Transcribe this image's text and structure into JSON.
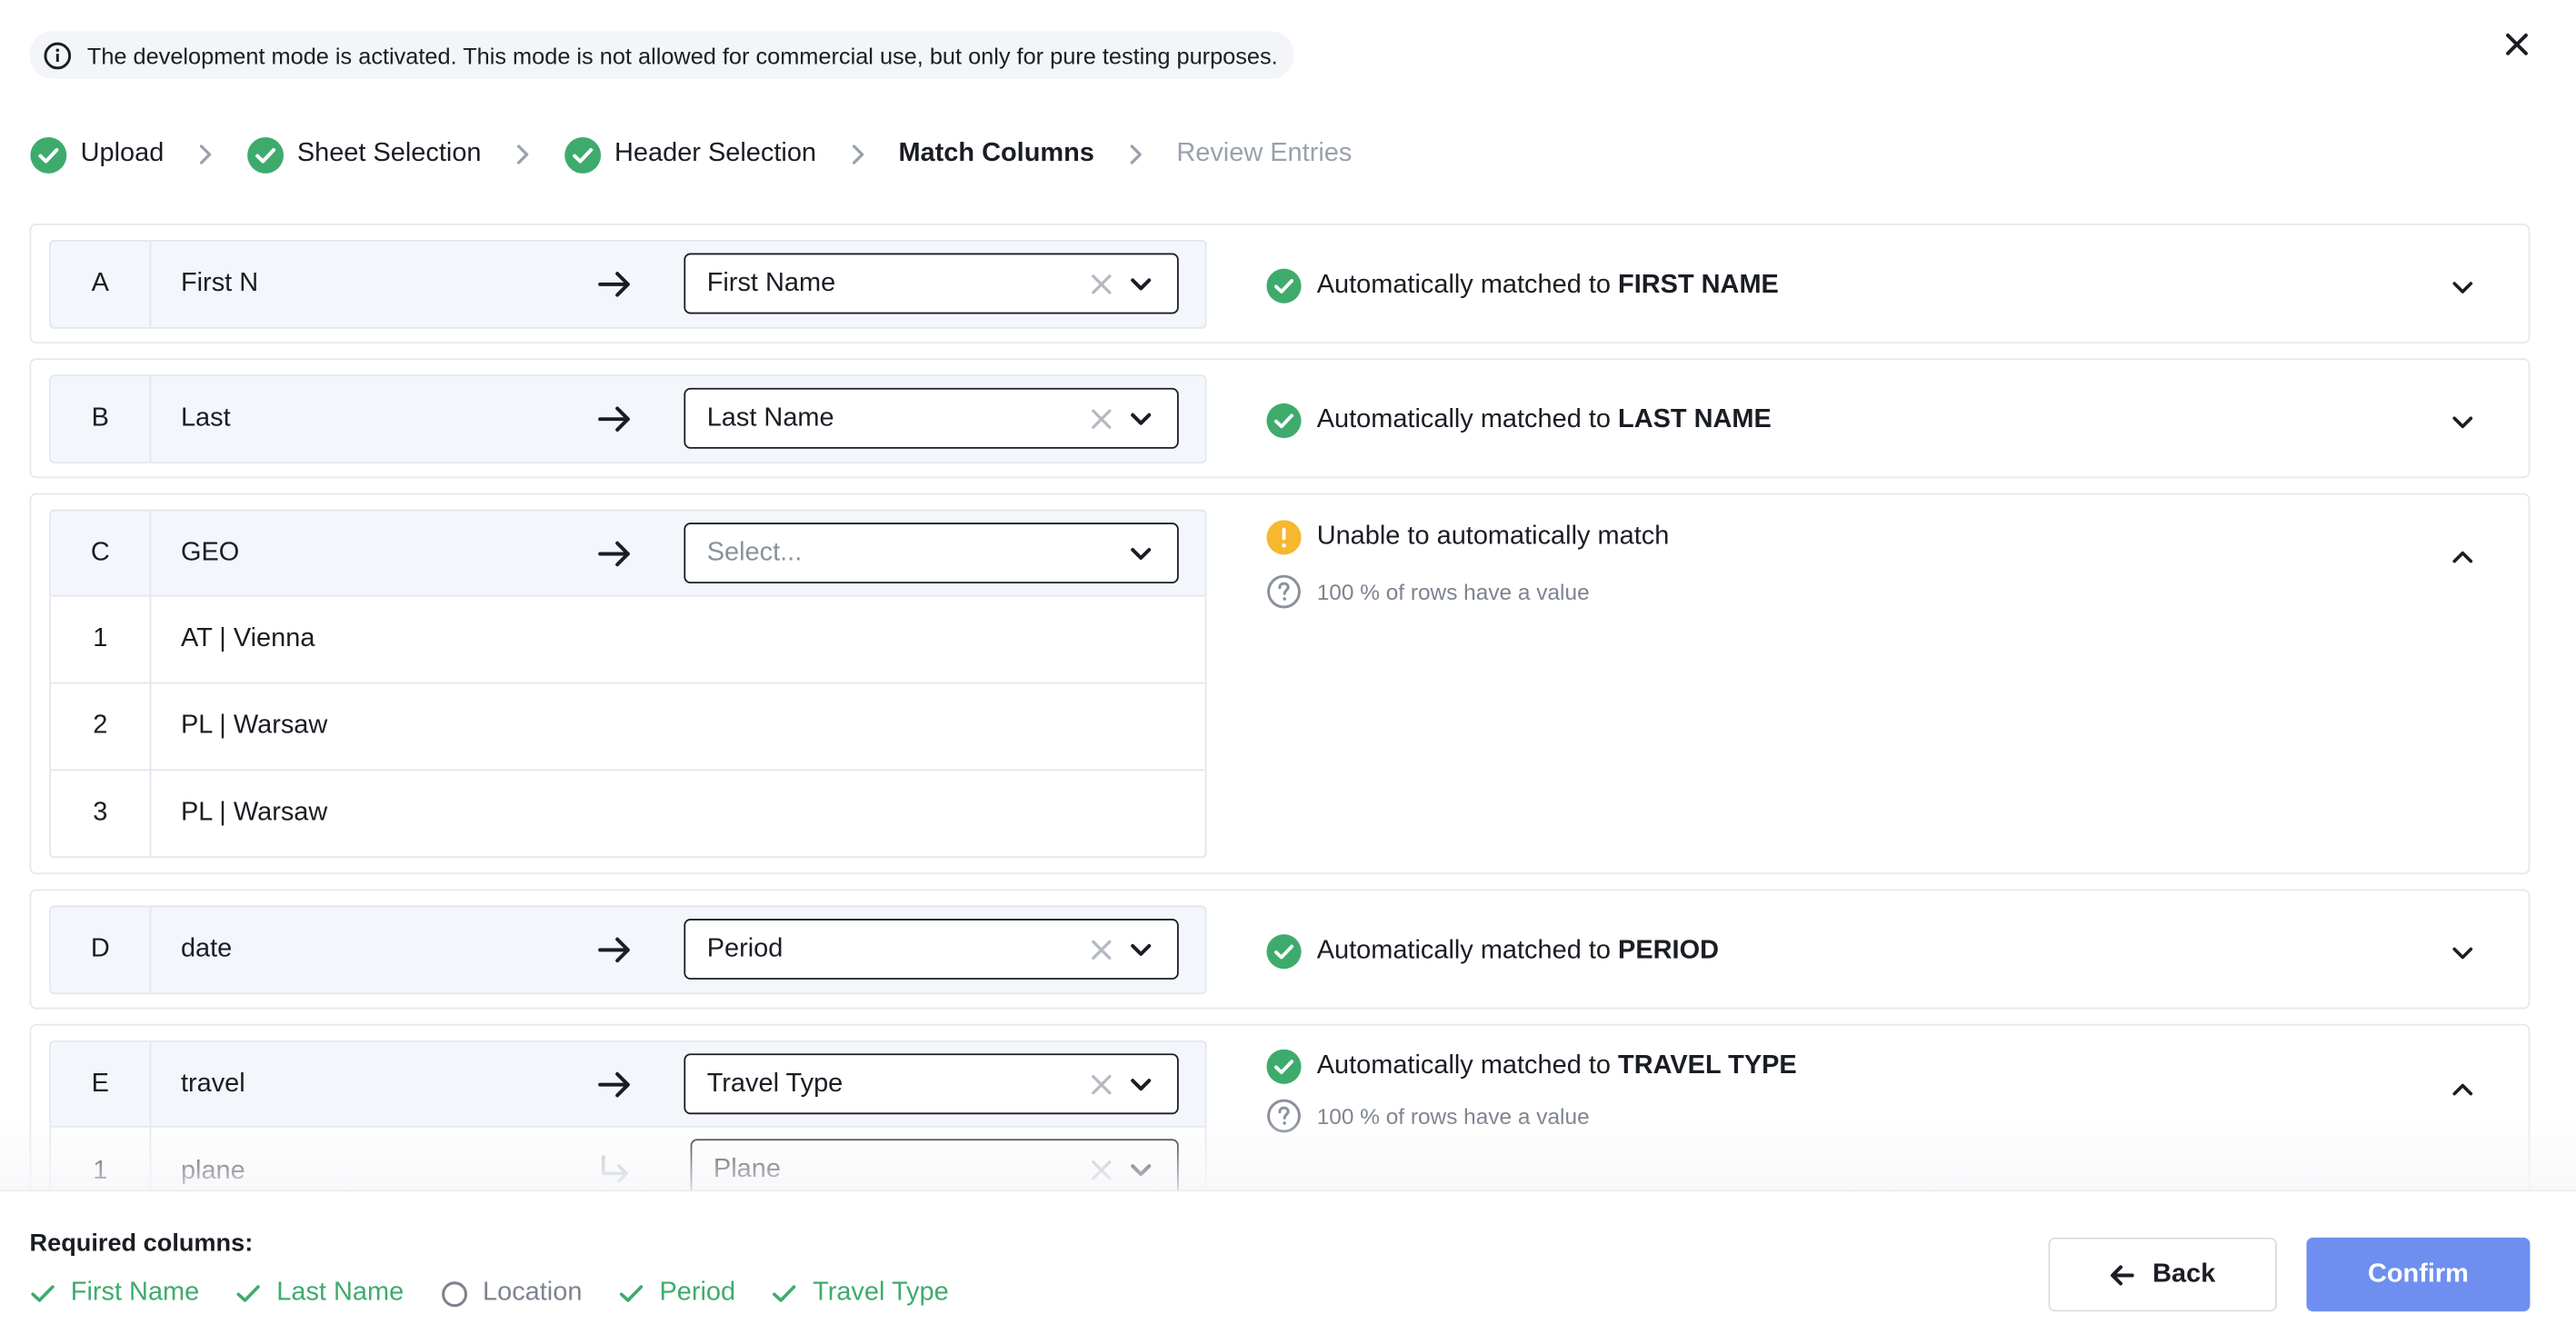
{
  "banner": {
    "text": "The development mode is activated. This mode is not allowed for commercial use, but only for pure testing purposes."
  },
  "steps": [
    {
      "label": "Upload",
      "state": "done"
    },
    {
      "label": "Sheet Selection",
      "state": "done"
    },
    {
      "label": "Header Selection",
      "state": "done"
    },
    {
      "label": "Match Columns",
      "state": "current"
    },
    {
      "label": "Review Entries",
      "state": "future"
    }
  ],
  "rows": [
    {
      "letter": "A",
      "header": "First N",
      "selected": "First Name",
      "status_prefix": "Automatically matched to",
      "status_target": "FIRST NAME"
    },
    {
      "letter": "B",
      "header": "Last",
      "selected": "Last Name",
      "status_prefix": "Automatically matched to",
      "status_target": "LAST NAME"
    },
    {
      "letter": "C",
      "header": "GEO",
      "placeholder": "Select...",
      "status_text": "Unable to automatically match",
      "sub_text": "100 % of rows have a value",
      "samples": [
        {
          "n": "1",
          "v": "AT | Vienna"
        },
        {
          "n": "2",
          "v": "PL | Warsaw"
        },
        {
          "n": "3",
          "v": "PL | Warsaw"
        }
      ]
    },
    {
      "letter": "D",
      "header": "date",
      "selected": "Period",
      "status_prefix": "Automatically matched to",
      "status_target": "PERIOD"
    },
    {
      "letter": "E",
      "header": "travel",
      "selected": "Travel Type",
      "status_prefix": "Automatically matched to",
      "status_target": "TRAVEL TYPE",
      "sub_text": "100 % of rows have a value",
      "values": [
        {
          "n": "1",
          "v": "plane",
          "selected": "Plane"
        }
      ]
    }
  ],
  "footer": {
    "required_title": "Required columns:",
    "required": [
      {
        "label": "First Name",
        "matched": true
      },
      {
        "label": "Last Name",
        "matched": true
      },
      {
        "label": "Location",
        "matched": false
      },
      {
        "label": "Period",
        "matched": true
      },
      {
        "label": "Travel Type",
        "matched": true
      }
    ],
    "back_label": "Back",
    "confirm_label": "Confirm"
  },
  "colors": {
    "success": "#3eab6d",
    "warning": "#f5b82e",
    "primary": "#6e8ff0",
    "text": "#1a1d23",
    "muted": "#7d848f"
  },
  "icons": {
    "done": "check-circle-icon",
    "warning": "exclamation-circle-icon",
    "help": "question-circle-icon",
    "info": "info-icon"
  }
}
